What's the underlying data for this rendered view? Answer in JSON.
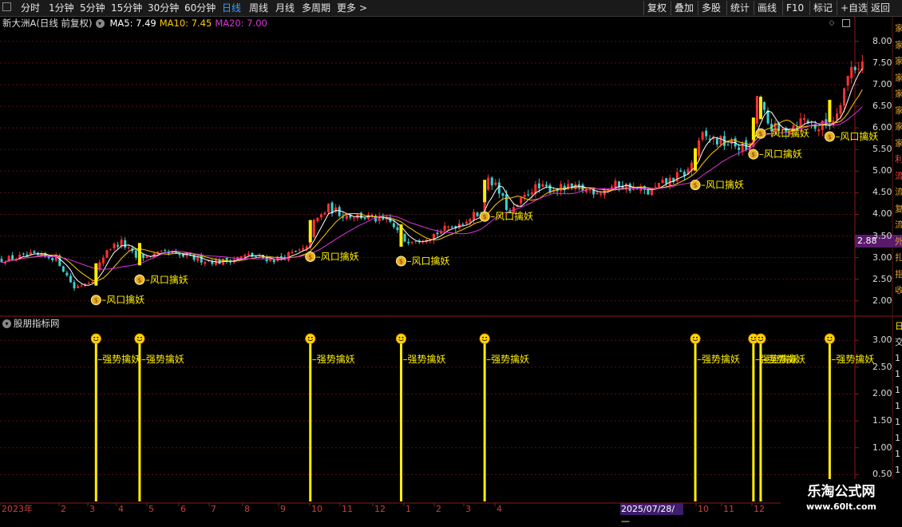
{
  "toolbar": {
    "tabs": [
      "分时",
      "1分钟",
      "5分钟",
      "15分钟",
      "30分钟",
      "60分钟",
      "日线",
      "周线",
      "月线",
      "多周期",
      "更多"
    ],
    "active_tab": "日线",
    "more_arrow": ">",
    "right_buttons": [
      "复权",
      "叠加",
      "多股",
      "统计",
      "画线",
      "F10",
      "标记",
      "+自选",
      "返回"
    ]
  },
  "main_header": {
    "stock": "新大洲A(日线 前复权)",
    "ma5_label": "MA5: 7.49",
    "ma10_label": "MA10: 7.45",
    "ma20_label": "MA20: 7.00",
    "ma5_color": "#ffffff",
    "ma10_color": "#ffcc00",
    "ma20_color": "#dd33dd"
  },
  "sub_header": {
    "title": "股朋指标网"
  },
  "current_price": "2.88",
  "cursor_date": "2025/07/28/—",
  "price_axis": [
    "8.00",
    "7.50",
    "7.00",
    "6.50",
    "6.00",
    "5.50",
    "5.00",
    "4.50",
    "4.00",
    "3.50",
    "3.00",
    "2.50",
    "2.00"
  ],
  "indicator_axis": [
    "3.00",
    "2.50",
    "2.00",
    "1.50",
    "1.00",
    "0.50"
  ],
  "date_axis": [
    "2023年",
    "2",
    "3",
    "4",
    "5",
    "6",
    "7",
    "8",
    "9",
    "10",
    "11",
    "12",
    "1",
    "2",
    "3",
    "4",
    "10",
    "11",
    "12"
  ],
  "right_edge_text": [
    "家",
    "家",
    "家",
    "家",
    "家",
    "家",
    "家",
    "家",
    "利",
    "流",
    "流",
    "复",
    "流",
    "外",
    "扎",
    "指",
    "收"
  ],
  "right_edge_sub": [
    "日",
    "交",
    "1",
    "1",
    "1",
    "1",
    "1",
    "1",
    "1",
    "1"
  ],
  "chart_data": {
    "type": "candlestick",
    "signal_label": "风口擒妖",
    "indicator_label": "强势擒妖",
    "price_range": [
      1.7,
      8.2
    ],
    "indicator_range": [
      0,
      3.3
    ],
    "signal_events": [
      {
        "index": 26,
        "price": 2.13
      },
      {
        "index": 38,
        "price": 2.6
      },
      {
        "index": 85,
        "price": 3.13
      },
      {
        "index": 110,
        "price": 3.03
      },
      {
        "index": 133,
        "price": 4.06
      },
      {
        "index": 191,
        "price": 4.79
      },
      {
        "index": 207,
        "price": 5.5
      },
      {
        "index": 209,
        "price": 5.98
      },
      {
        "index": 228,
        "price": 5.91
      }
    ],
    "indicator_events": [
      26,
      38,
      85,
      110,
      133,
      191,
      207,
      209,
      228
    ],
    "indicator_value": 3.0
  },
  "watermark": {
    "line1": "乐淘公式网",
    "line2": "www.60lt.com"
  }
}
